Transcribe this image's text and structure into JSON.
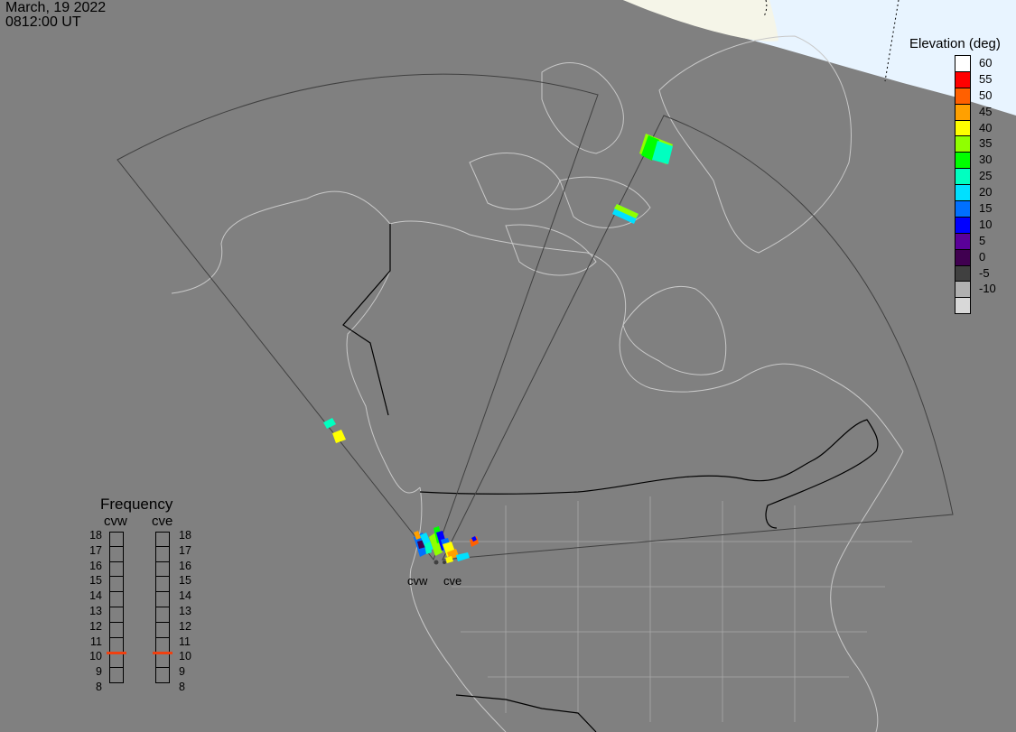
{
  "header": {
    "date": "March, 19 2022",
    "time": "0812:00 UT"
  },
  "elevation_legend": {
    "title": "Elevation (deg)",
    "levels": [
      {
        "label": "60",
        "color": "#ffffff"
      },
      {
        "label": "55",
        "color": "#ff0000"
      },
      {
        "label": "50",
        "color": "#ff6000"
      },
      {
        "label": "45",
        "color": "#ffa000"
      },
      {
        "label": "40",
        "color": "#ffff00"
      },
      {
        "label": "35",
        "color": "#90ff00"
      },
      {
        "label": "30",
        "color": "#00ff00"
      },
      {
        "label": "25",
        "color": "#00ffc0"
      },
      {
        "label": "20",
        "color": "#00e0ff"
      },
      {
        "label": "15",
        "color": "#0070ff"
      },
      {
        "label": "10",
        "color": "#0000ff"
      },
      {
        "label": "5",
        "color": "#5a0099"
      },
      {
        "label": "0",
        "color": "#400050"
      },
      {
        "label": "-5",
        "color": "#404040"
      },
      {
        "label": "-10",
        "color": "#b0b0b0"
      }
    ],
    "bottom_color": "#d8d8d8"
  },
  "frequency_legend": {
    "title": "Frequency",
    "radars": [
      {
        "name": "cvw",
        "frequency_mhz": 10.5
      },
      {
        "name": "cve",
        "frequency_mhz": 10.5
      }
    ],
    "ticks": [
      "18",
      "17",
      "16",
      "15",
      "14",
      "13",
      "12",
      "11",
      "10",
      "9",
      "8"
    ],
    "marker_color": "#f04010"
  },
  "sites": [
    {
      "name": "cvw"
    },
    {
      "name": "cve"
    }
  ],
  "map": {
    "background": "#808080",
    "land_outline": "#c8c8c8",
    "border_color": "#000000",
    "fov_outline": "#404040",
    "ice_color": "#e8f4ff"
  }
}
